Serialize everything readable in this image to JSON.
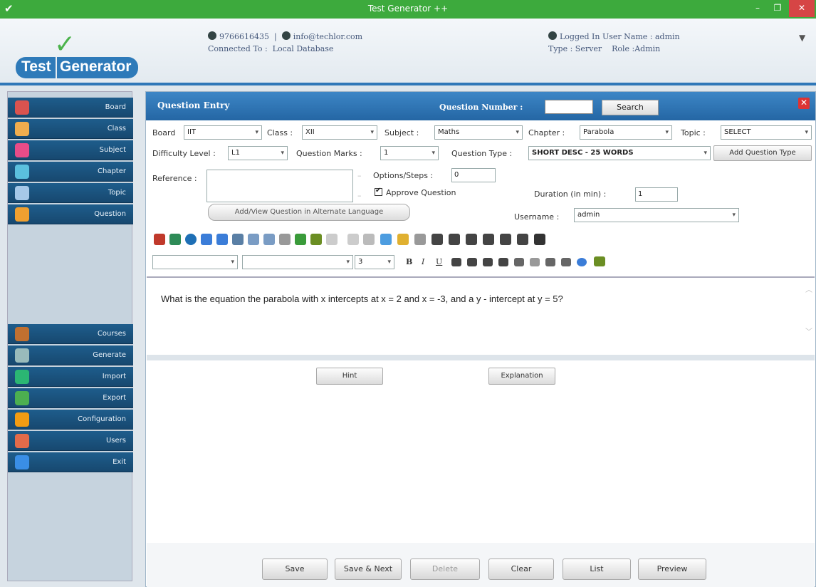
{
  "window": {
    "title": "Test Generator ++"
  },
  "logo": {
    "word1": "Test",
    "word2": "Generator"
  },
  "header": {
    "phone": "9766616435",
    "separator": "|",
    "email": "info@techlor.com",
    "connected_label": "Connected To :",
    "connected_value": "Local Database",
    "logged_in": "Logged In User Name : admin",
    "type_label": "Type : Server",
    "role_label": "Role :Admin"
  },
  "sidebar": {
    "items": [
      {
        "label": "Board",
        "color": "#d9534f"
      },
      {
        "label": "Class",
        "color": "#f0ad4e"
      },
      {
        "label": "Subject",
        "color": "#e84c88"
      },
      {
        "label": "Chapter",
        "color": "#5bc0de"
      },
      {
        "label": "Topic",
        "color": "#a6c8e8"
      },
      {
        "label": "Question",
        "color": "#f0a030"
      },
      {
        "label": "Courses",
        "color": "#c07030"
      },
      {
        "label": "Generate",
        "color": "#9bb"
      },
      {
        "label": "Import",
        "color": "#2bb673"
      },
      {
        "label": "Export",
        "color": "#4caf50"
      },
      {
        "label": "Configuration",
        "color": "#f39c12"
      },
      {
        "label": "Users",
        "color": "#e26b4a"
      },
      {
        "label": "Exit",
        "color": "#3a8ee6"
      }
    ]
  },
  "panel": {
    "title": "Question Entry",
    "qnum_label": "Question Number :",
    "search_button": "Search"
  },
  "form": {
    "board_label": "Board",
    "board_value": "IIT",
    "class_label": "Class :",
    "class_value": "XII",
    "subject_label": "Subject :",
    "subject_value": "Maths",
    "chapter_label": "Chapter :",
    "chapter_value": "Parabola",
    "topic_label": "Topic :",
    "topic_value": "SELECT",
    "difficulty_label": "Difficulty Level :",
    "difficulty_value": "L1",
    "marks_label": "Question Marks :",
    "marks_value": "1",
    "qtype_label": "Question Type :",
    "qtype_value": "SHORT DESC - 25 WORDS",
    "add_qtype_button": "Add Question Type",
    "reference_label": "Reference :",
    "options_label": "Options/Steps :",
    "options_value": "0",
    "approve_label": "Approve Question",
    "duration_label": "Duration (in min) :",
    "duration_value": "1",
    "alt_lang_button": "Add/View Question in Alternate Language",
    "username_label": "Username :",
    "username_value": "admin"
  },
  "format": {
    "font_size": "3",
    "bold": "B",
    "italic": "I",
    "underline": "U"
  },
  "editor": {
    "content": "What is the equation the parabola with x intercepts at x = 2 and x = -3, and a y - intercept at y = 5?"
  },
  "buttons": {
    "hint": "Hint",
    "explanation": "Explanation",
    "save": "Save",
    "save_next": "Save & Next",
    "delete": "Delete",
    "clear": "Clear",
    "list": "List",
    "preview": "Preview"
  }
}
